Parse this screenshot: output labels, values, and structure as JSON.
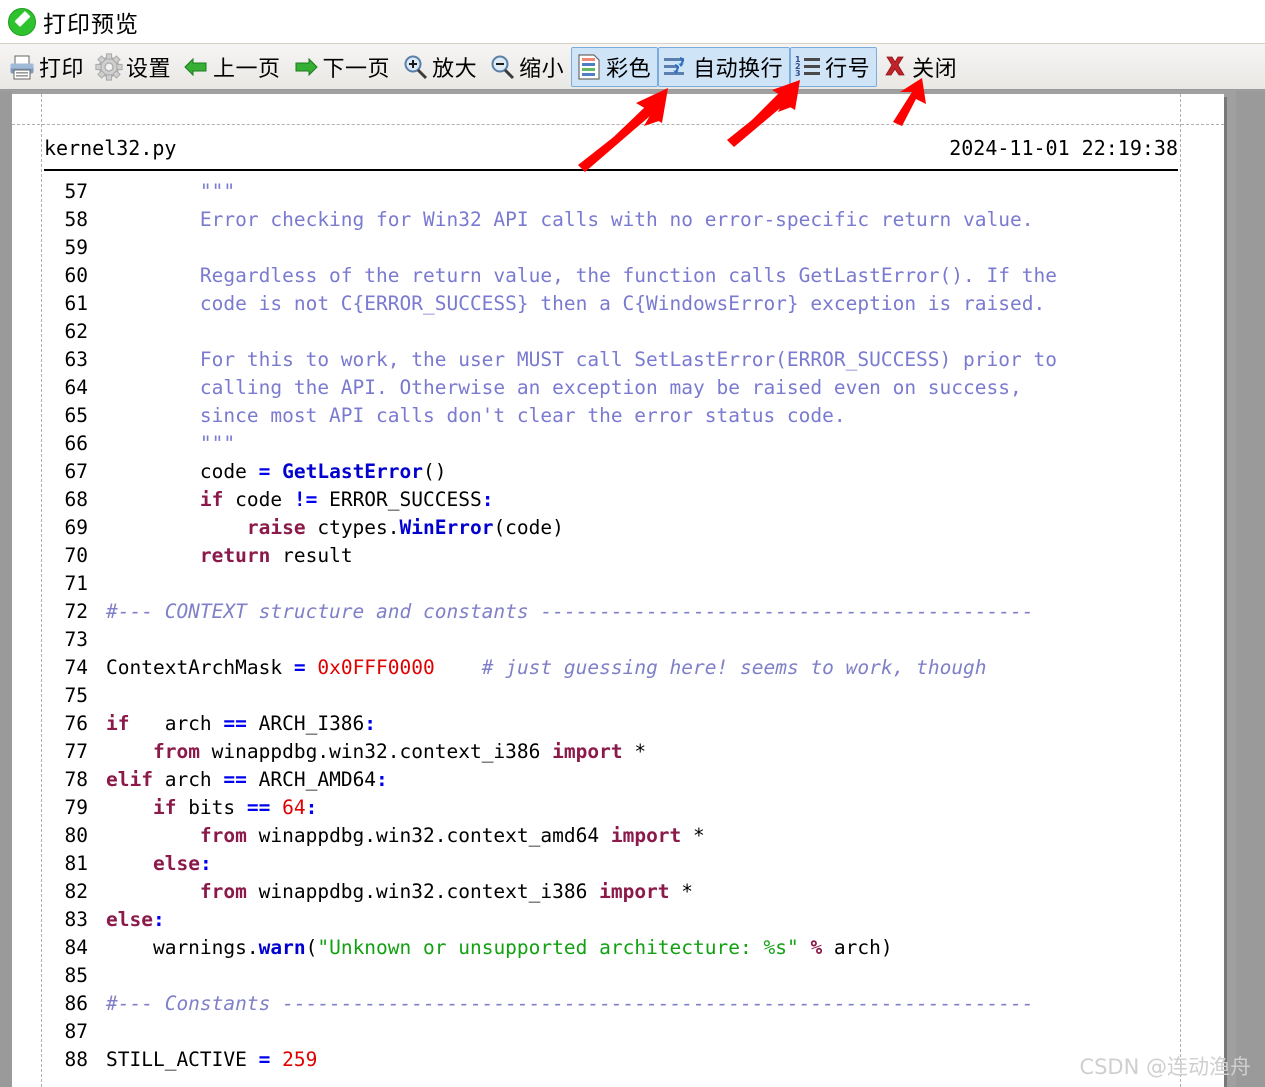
{
  "window": {
    "title": "打印预览",
    "title_icon": "pencil-circle-icon"
  },
  "toolbar": {
    "buttons": [
      {
        "id": "print",
        "label": "打印",
        "icon": "printer-icon",
        "toggled": false
      },
      {
        "id": "settings",
        "label": "设置",
        "icon": "gear-icon",
        "toggled": false
      },
      {
        "id": "prev",
        "label": "上一页",
        "icon": "arrow-left-icon",
        "toggled": false
      },
      {
        "id": "next",
        "label": "下一页",
        "icon": "arrow-right-icon",
        "toggled": false
      },
      {
        "id": "zoomin",
        "label": "放大",
        "icon": "zoom-in-icon",
        "toggled": false
      },
      {
        "id": "zoomout",
        "label": "缩小",
        "icon": "zoom-out-icon",
        "toggled": false
      },
      {
        "id": "color",
        "label": "彩色",
        "icon": "color-document-icon",
        "toggled": true
      },
      {
        "id": "wrap",
        "label": "自动换行",
        "icon": "word-wrap-icon",
        "toggled": true
      },
      {
        "id": "lineno",
        "label": "行号",
        "icon": "line-numbers-icon",
        "toggled": true
      },
      {
        "id": "close",
        "label": "关闭",
        "icon": "close-x-icon",
        "toggled": false
      }
    ]
  },
  "document": {
    "filename": "kernel32.py",
    "timestamp": "2024-11-01 22:19:38"
  },
  "code": {
    "lines": [
      {
        "n": "57",
        "tokens": [
          {
            "t": "str",
            "v": "        \"\"\""
          }
        ]
      },
      {
        "n": "58",
        "tokens": [
          {
            "t": "str",
            "v": "        Error checking for Win32 API calls with no error-specific return value."
          }
        ]
      },
      {
        "n": "59",
        "tokens": [
          {
            "t": "pl",
            "v": ""
          }
        ]
      },
      {
        "n": "60",
        "tokens": [
          {
            "t": "str",
            "v": "        Regardless of the return value, the function calls GetLastError(). If the"
          }
        ]
      },
      {
        "n": "61",
        "tokens": [
          {
            "t": "str",
            "v": "        code is not C{ERROR_SUCCESS} then a C{WindowsError} exception is raised."
          }
        ]
      },
      {
        "n": "62",
        "tokens": [
          {
            "t": "pl",
            "v": ""
          }
        ]
      },
      {
        "n": "63",
        "tokens": [
          {
            "t": "str",
            "v": "        For this to work, the user MUST call SetLastError(ERROR_SUCCESS) prior to"
          }
        ]
      },
      {
        "n": "64",
        "tokens": [
          {
            "t": "str",
            "v": "        calling the API. Otherwise an exception may be raised even on success,"
          }
        ]
      },
      {
        "n": "65",
        "tokens": [
          {
            "t": "str",
            "v": "        since most API calls don't clear the error status code."
          }
        ]
      },
      {
        "n": "66",
        "tokens": [
          {
            "t": "str",
            "v": "        \"\"\""
          }
        ]
      },
      {
        "n": "67",
        "tokens": [
          {
            "t": "pl",
            "v": "        code "
          },
          {
            "t": "opb",
            "v": "="
          },
          {
            "t": "pl",
            "v": " "
          },
          {
            "t": "fn",
            "v": "GetLastError"
          },
          {
            "t": "pl",
            "v": "()"
          }
        ]
      },
      {
        "n": "68",
        "tokens": [
          {
            "t": "pl",
            "v": "        "
          },
          {
            "t": "kw",
            "v": "if"
          },
          {
            "t": "pl",
            "v": " code "
          },
          {
            "t": "opb",
            "v": "!="
          },
          {
            "t": "pl",
            "v": " ERROR_SUCCESS"
          },
          {
            "t": "opb",
            "v": ":"
          }
        ]
      },
      {
        "n": "69",
        "tokens": [
          {
            "t": "pl",
            "v": "            "
          },
          {
            "t": "kw",
            "v": "raise"
          },
          {
            "t": "pl",
            "v": " ctypes."
          },
          {
            "t": "fn",
            "v": "WinError"
          },
          {
            "t": "pl",
            "v": "(code)"
          }
        ]
      },
      {
        "n": "70",
        "tokens": [
          {
            "t": "pl",
            "v": "        "
          },
          {
            "t": "kw",
            "v": "return"
          },
          {
            "t": "pl",
            "v": " result"
          }
        ]
      },
      {
        "n": "71",
        "tokens": [
          {
            "t": "pl",
            "v": ""
          }
        ]
      },
      {
        "n": "72",
        "tokens": [
          {
            "t": "com",
            "v": "#--- CONTEXT structure and constants ------------------------------------------"
          }
        ]
      },
      {
        "n": "73",
        "tokens": [
          {
            "t": "pl",
            "v": ""
          }
        ]
      },
      {
        "n": "74",
        "tokens": [
          {
            "t": "pl",
            "v": "ContextArchMask "
          },
          {
            "t": "opb",
            "v": "="
          },
          {
            "t": "pl",
            "v": " "
          },
          {
            "t": "num",
            "v": "0x0FFF0000"
          },
          {
            "t": "pl",
            "v": "    "
          },
          {
            "t": "com",
            "v": "# just guessing here! seems to work, though"
          }
        ]
      },
      {
        "n": "75",
        "tokens": [
          {
            "t": "pl",
            "v": ""
          }
        ]
      },
      {
        "n": "76",
        "tokens": [
          {
            "t": "kw",
            "v": "if"
          },
          {
            "t": "pl",
            "v": "   arch "
          },
          {
            "t": "opb",
            "v": "=="
          },
          {
            "t": "pl",
            "v": " ARCH_I386"
          },
          {
            "t": "opb",
            "v": ":"
          }
        ]
      },
      {
        "n": "77",
        "tokens": [
          {
            "t": "pl",
            "v": "    "
          },
          {
            "t": "kw",
            "v": "from"
          },
          {
            "t": "pl",
            "v": " winappdbg.win32.context_i386 "
          },
          {
            "t": "kw",
            "v": "import"
          },
          {
            "t": "pl",
            "v": " *"
          }
        ]
      },
      {
        "n": "78",
        "tokens": [
          {
            "t": "kw",
            "v": "elif"
          },
          {
            "t": "pl",
            "v": " arch "
          },
          {
            "t": "opb",
            "v": "=="
          },
          {
            "t": "pl",
            "v": " ARCH_AMD64"
          },
          {
            "t": "opb",
            "v": ":"
          }
        ]
      },
      {
        "n": "79",
        "tokens": [
          {
            "t": "pl",
            "v": "    "
          },
          {
            "t": "kw",
            "v": "if"
          },
          {
            "t": "pl",
            "v": " bits "
          },
          {
            "t": "opb",
            "v": "=="
          },
          {
            "t": "pl",
            "v": " "
          },
          {
            "t": "num",
            "v": "64"
          },
          {
            "t": "opb",
            "v": ":"
          }
        ]
      },
      {
        "n": "80",
        "tokens": [
          {
            "t": "pl",
            "v": "        "
          },
          {
            "t": "kw",
            "v": "from"
          },
          {
            "t": "pl",
            "v": " winappdbg.win32.context_amd64 "
          },
          {
            "t": "kw",
            "v": "import"
          },
          {
            "t": "pl",
            "v": " *"
          }
        ]
      },
      {
        "n": "81",
        "tokens": [
          {
            "t": "pl",
            "v": "    "
          },
          {
            "t": "kw",
            "v": "else"
          },
          {
            "t": "opb",
            "v": ":"
          }
        ]
      },
      {
        "n": "82",
        "tokens": [
          {
            "t": "pl",
            "v": "        "
          },
          {
            "t": "kw",
            "v": "from"
          },
          {
            "t": "pl",
            "v": " winappdbg.win32.context_i386 "
          },
          {
            "t": "kw",
            "v": "import"
          },
          {
            "t": "pl",
            "v": " *"
          }
        ]
      },
      {
        "n": "83",
        "tokens": [
          {
            "t": "kw",
            "v": "else"
          },
          {
            "t": "opb",
            "v": ":"
          }
        ]
      },
      {
        "n": "84",
        "tokens": [
          {
            "t": "pl",
            "v": "    warnings."
          },
          {
            "t": "fn",
            "v": "warn"
          },
          {
            "t": "pl",
            "v": "("
          },
          {
            "t": "s",
            "v": "\"Unknown or unsupported architecture: %s\""
          },
          {
            "t": "pl",
            "v": " "
          },
          {
            "t": "kw",
            "v": "%"
          },
          {
            "t": "pl",
            "v": " arch)"
          }
        ]
      },
      {
        "n": "85",
        "tokens": [
          {
            "t": "pl",
            "v": ""
          }
        ]
      },
      {
        "n": "86",
        "tokens": [
          {
            "t": "com",
            "v": "#--- Constants ----------------------------------------------------------------"
          }
        ]
      },
      {
        "n": "87",
        "tokens": [
          {
            "t": "pl",
            "v": ""
          }
        ]
      },
      {
        "n": "88",
        "tokens": [
          {
            "t": "pl",
            "v": "STILL_ACTIVE "
          },
          {
            "t": "opb",
            "v": "="
          },
          {
            "t": "pl",
            "v": " "
          },
          {
            "t": "num",
            "v": "259"
          }
        ]
      }
    ]
  },
  "watermark": "CSDN @连动渔舟",
  "colors": {
    "toolbar_toggle_bg": "#cfe4f7",
    "toolbar_toggle_border": "#7aaddc",
    "annotation_arrow": "#ff0000",
    "page_bg": "#ffffff",
    "app_bg": "#a0a0a0",
    "syntax_keyword": "#8b1a4a",
    "syntax_function": "#0000d0",
    "syntax_number": "#e00000",
    "syntax_string": "#11a111",
    "syntax_comment": "#8080c8",
    "syntax_docstring": "#7a7ad0",
    "syntax_operator": "#0000ee"
  }
}
